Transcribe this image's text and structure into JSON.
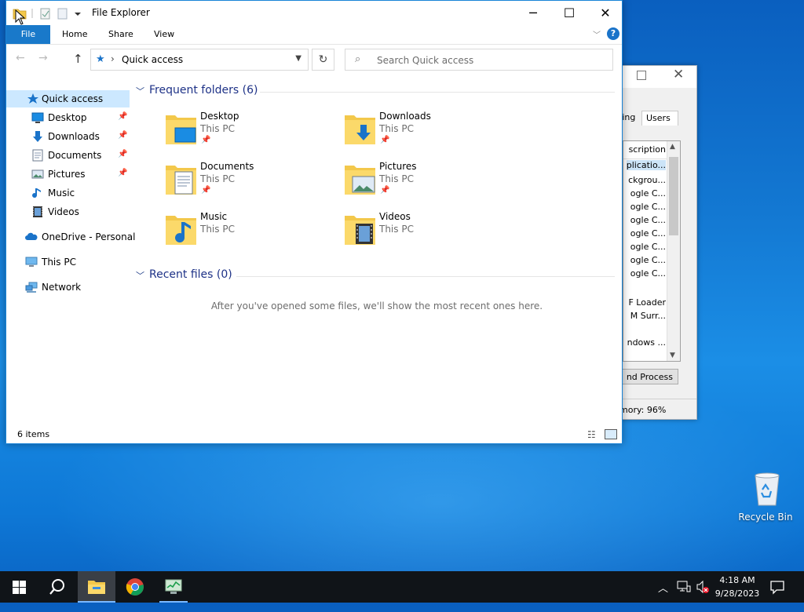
{
  "desktop": {
    "recycle_bin_label": "Recycle Bin"
  },
  "task_manager": {
    "tabs": [
      "king",
      "Users"
    ],
    "column_header": "scription",
    "rows": [
      "plicatio...",
      "ckgrou...",
      "ogle C...",
      "ogle C...",
      "ogle C...",
      "ogle C...",
      "ogle C...",
      "ogle C...",
      "ogle C...",
      "",
      "F Loader",
      "M Surr...",
      "",
      "ndows ..."
    ],
    "end_process_label": "nd Process",
    "status_text": "mory: 96%"
  },
  "explorer": {
    "title": "File Explorer",
    "controls": {
      "minimize": "─",
      "maximize": "☐",
      "close": "✕"
    },
    "ribbon_tabs": {
      "file": "File",
      "home": "Home",
      "share": "Share",
      "view": "View"
    },
    "help": "?",
    "address": {
      "path": "Quick access",
      "chevron": "›"
    },
    "search": {
      "placeholder": "Search Quick access"
    },
    "nav_pane": {
      "items": [
        {
          "label": "Quick access",
          "icon": "star-icon",
          "selected": true,
          "pinned": false
        },
        {
          "label": "Desktop",
          "icon": "desktop-icon",
          "pinned": true
        },
        {
          "label": "Downloads",
          "icon": "download-icon",
          "pinned": true
        },
        {
          "label": "Documents",
          "icon": "document-icon",
          "pinned": true
        },
        {
          "label": "Pictures",
          "icon": "picture-icon",
          "pinned": true
        },
        {
          "label": "Music",
          "icon": "music-icon",
          "pinned": false
        },
        {
          "label": "Videos",
          "icon": "video-icon",
          "pinned": false
        },
        {
          "label": "OneDrive - Personal",
          "icon": "cloud-icon",
          "pinned": false
        },
        {
          "label": "This PC",
          "icon": "pc-icon",
          "pinned": false
        },
        {
          "label": "Network",
          "icon": "network-icon",
          "pinned": false
        }
      ]
    },
    "frequent_folders": {
      "title": "Frequent folders (6)",
      "items": [
        {
          "name": "Desktop",
          "location": "This PC",
          "pinned": true
        },
        {
          "name": "Downloads",
          "location": "This PC",
          "pinned": true
        },
        {
          "name": "Documents",
          "location": "This PC",
          "pinned": true
        },
        {
          "name": "Pictures",
          "location": "This PC",
          "pinned": true
        },
        {
          "name": "Music",
          "location": "This PC",
          "pinned": false
        },
        {
          "name": "Videos",
          "location": "This PC",
          "pinned": false
        }
      ]
    },
    "recent_files": {
      "title": "Recent files (0)",
      "empty_message": "After you've opened some files, we'll show the most recent ones here."
    },
    "status": {
      "item_count": "6 items"
    }
  },
  "taskbar": {
    "apps": [
      "start-icon",
      "search-icon",
      "file-explorer-icon",
      "chrome-icon",
      "task-manager-icon"
    ],
    "clock": {
      "time": "4:18 AM",
      "date": "9/28/2023"
    }
  },
  "colors": {
    "accent": "#1979ca",
    "selection": "#cce8ff",
    "section_title": "#1e3287",
    "folder_yellow": "#f3c84b"
  }
}
